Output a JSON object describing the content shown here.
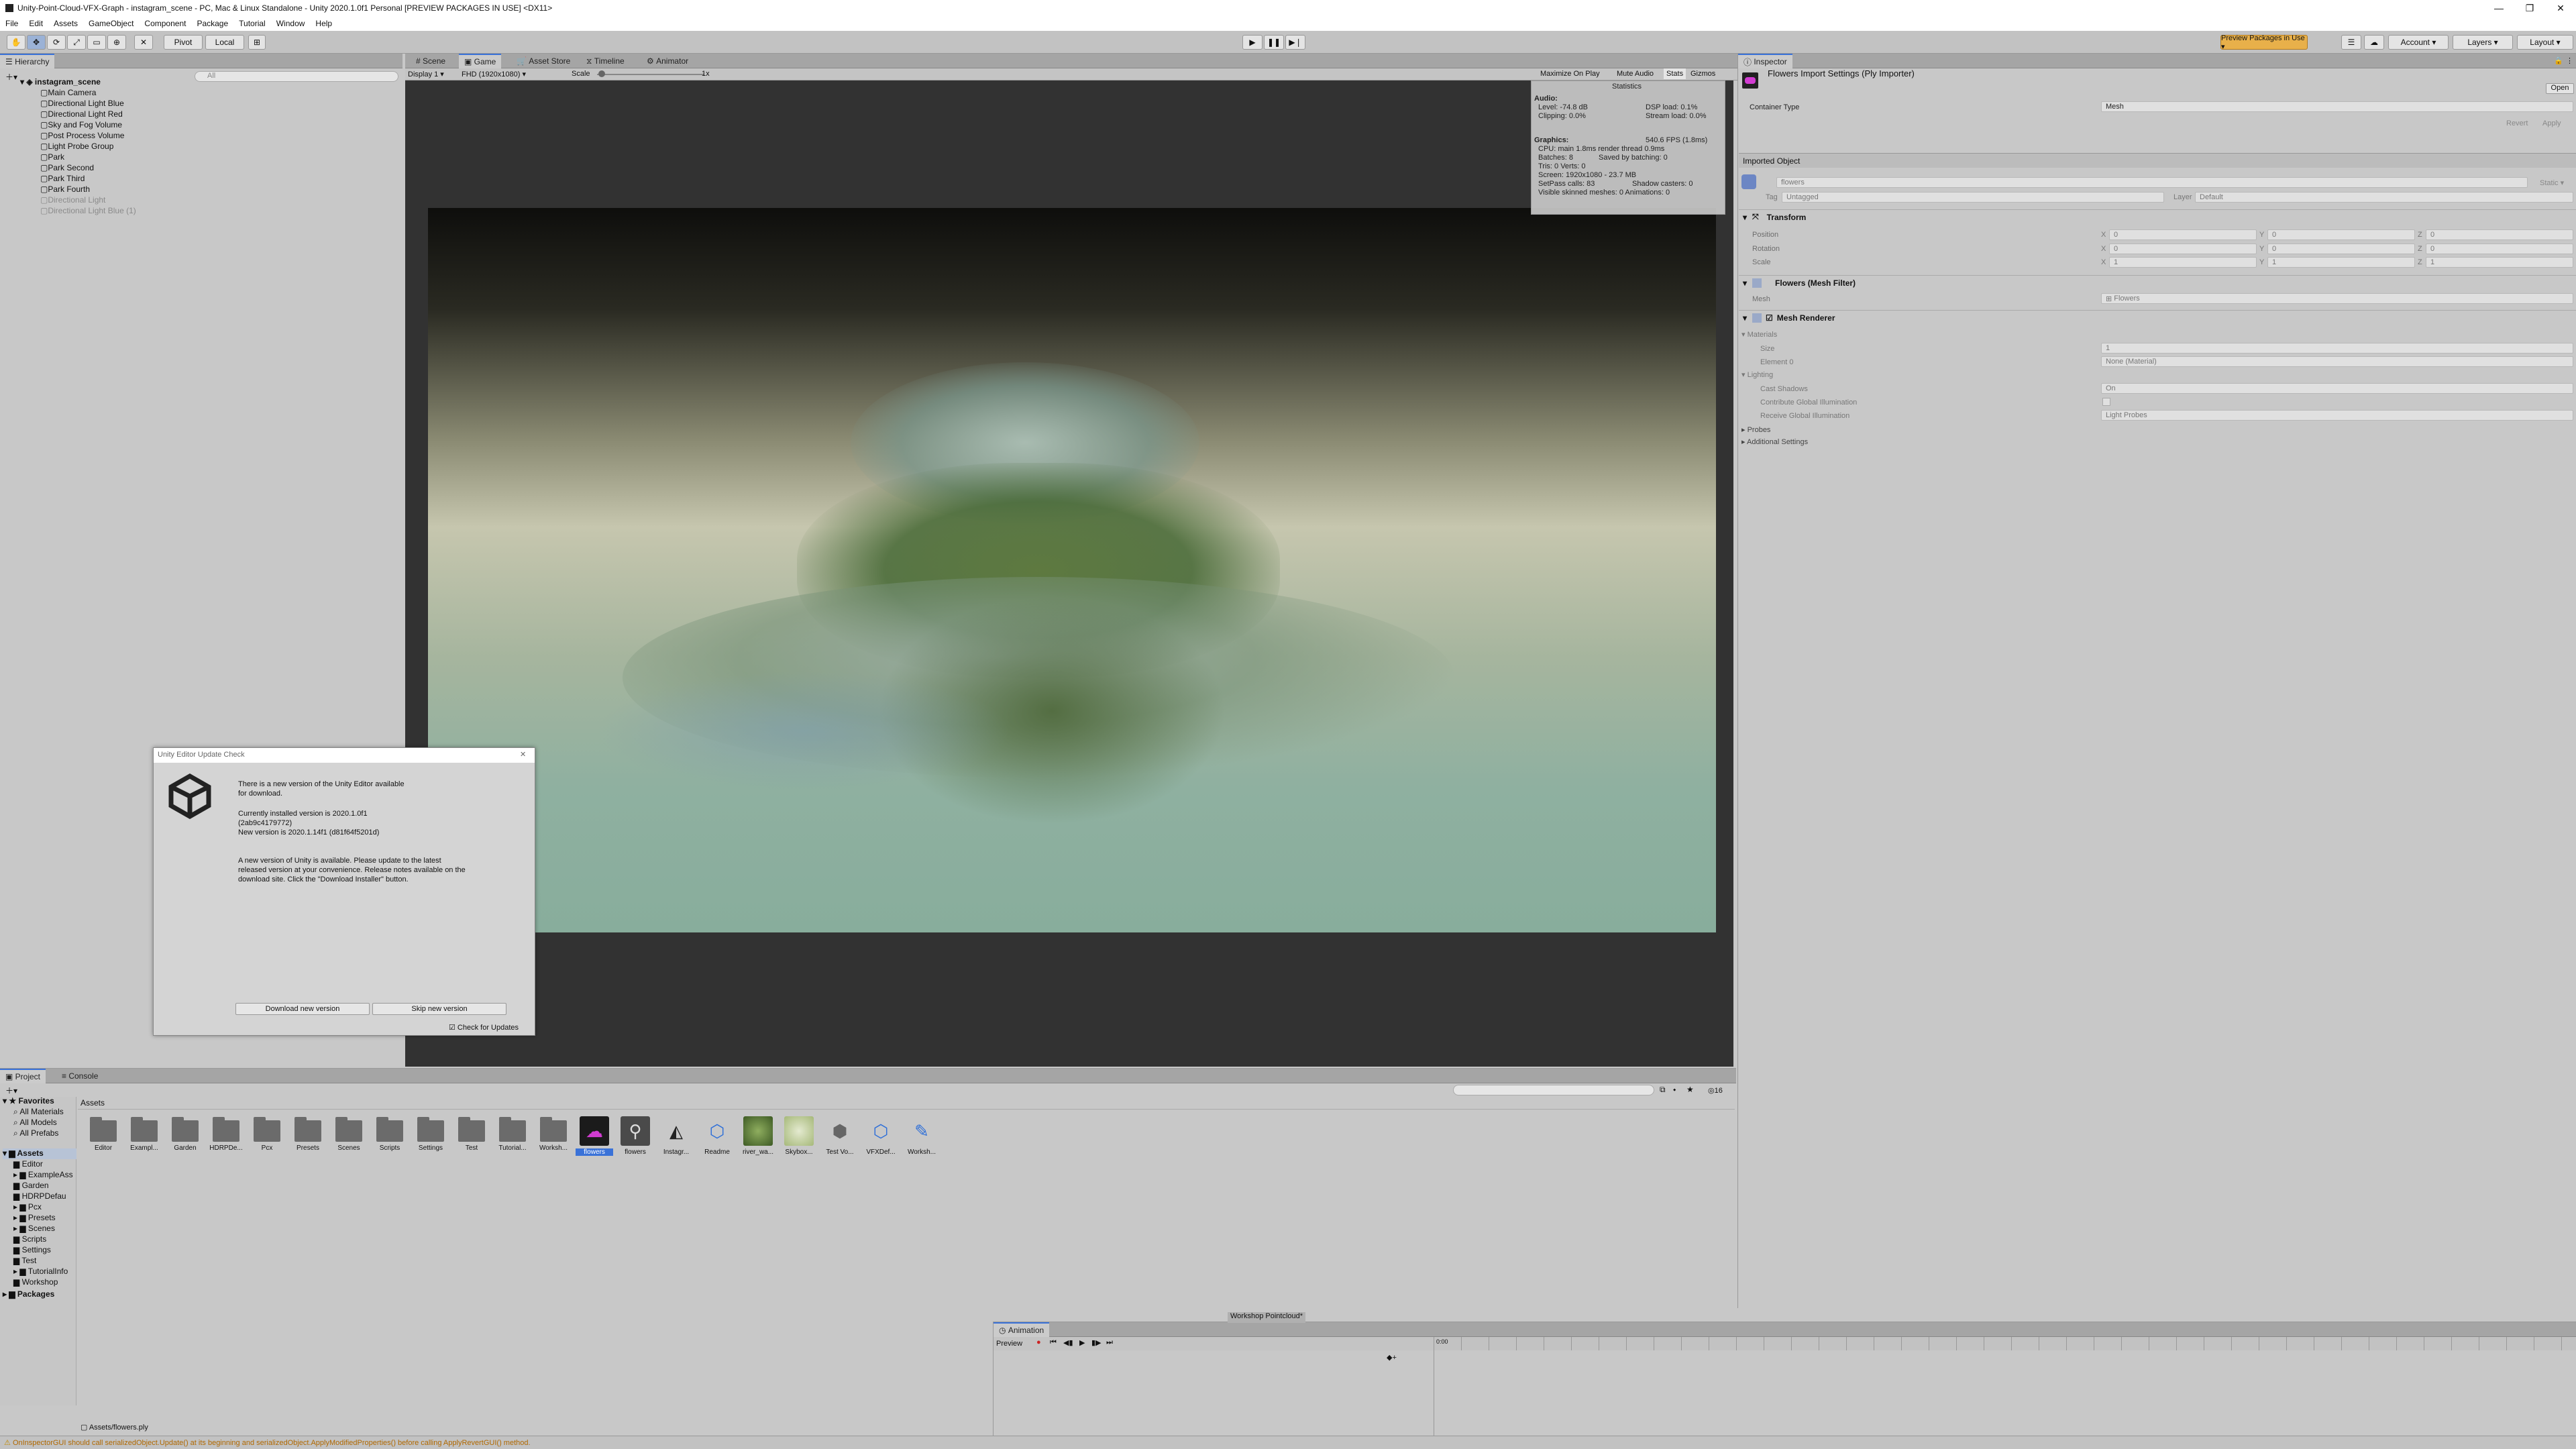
{
  "window": {
    "title": "Unity-Point-Cloud-VFX-Graph - instagram_scene - PC, Mac & Linux Standalone - Unity 2020.1.0f1 Personal [PREVIEW PACKAGES IN USE] <DX11>",
    "controls": [
      "—",
      "❐",
      "✕"
    ]
  },
  "menu": [
    "File",
    "Edit",
    "Assets",
    "GameObject",
    "Component",
    "Package",
    "Tutorial",
    "Window",
    "Help"
  ],
  "toolbar": {
    "pivot": "Pivot",
    "local": "Local",
    "preview_packages": "Preview Packages in Use ▾",
    "account": "Account ▾",
    "layers": "Layers ▾",
    "layout": "Layout ▾"
  },
  "hierarchy": {
    "tab": "Hierarchy",
    "search_placeholder": "All",
    "scene": "instagram_scene",
    "items": [
      {
        "label": "Main Camera",
        "dim": false
      },
      {
        "label": "Directional Light Blue",
        "dim": false
      },
      {
        "label": "Directional Light Red",
        "dim": false
      },
      {
        "label": "Sky and Fog Volume",
        "dim": false
      },
      {
        "label": "Post Process Volume",
        "dim": false
      },
      {
        "label": "Light Probe Group",
        "dim": false
      },
      {
        "label": "Park",
        "dim": false
      },
      {
        "label": "Park Second",
        "dim": false
      },
      {
        "label": "Park Third",
        "dim": false
      },
      {
        "label": "Park Fourth",
        "dim": false
      },
      {
        "label": "Directional Light",
        "dim": true
      },
      {
        "label": "Directional Light Blue (1)",
        "dim": true
      }
    ]
  },
  "center_tabs": [
    "Scene",
    "Game",
    "Asset Store",
    "Timeline",
    "Animator"
  ],
  "game_bar": {
    "display": "Display 1",
    "resolution": "FHD (1920x1080)",
    "scale_label": "Scale",
    "scale_value": "1x",
    "maximize": "Maximize On Play",
    "mute": "Mute Audio",
    "stats": "Stats",
    "gizmos": "Gizmos"
  },
  "statistics": {
    "title": "Statistics",
    "audio_hdr": "Audio:",
    "level": "Level: -74.8 dB",
    "dsp": "DSP load: 0.1%",
    "clipping": "Clipping: 0.0%",
    "stream": "Stream load: 0.0%",
    "graphics_hdr": "Graphics:",
    "fps": "540.6 FPS (1.8ms)",
    "cpu": "CPU: main 1.8ms  render thread 0.9ms",
    "batches": "Batches: 8",
    "saved": "Saved by batching: 0",
    "tris": "Tris: 0   Verts: 0",
    "screen": "Screen: 1920x1080 - 23.7 MB",
    "setpass": "SetPass calls: 83",
    "shadow": "Shadow casters: 0",
    "skinned": "Visible skinned meshes: 0  Animations: 0"
  },
  "update_dialog": {
    "title": "Unity Editor Update Check",
    "line1": "There is a new version of the Unity Editor available",
    "line2": "for download.",
    "current": "Currently installed version is 2020.1.0f1",
    "hash": "(2ab9c4179772)",
    "new_version": "New version is 2020.1.14f1 (d81f64f5201d)",
    "msg1": "A new version of Unity is available. Please update to the latest",
    "msg2": "released version at your convenience. Release notes available on the",
    "msg3": "download site. Click the \"Download Installer\" button.",
    "download_btn": "Download new version",
    "skip_btn": "Skip new version",
    "check_label": "Check for Updates"
  },
  "inspector": {
    "tab": "Inspector",
    "title": "Flowers Import Settings (Ply Importer)",
    "open": "Open",
    "container_label": "Container Type",
    "container_value": "Mesh",
    "revert": "Revert",
    "apply": "Apply",
    "imported_object": "Imported Object",
    "object_name": "flowers",
    "static": "Static ▾",
    "tag_label": "Tag",
    "tag_value": "Untagged",
    "layer_label": "Layer",
    "layer_value": "Default",
    "transform": "Transform",
    "position": "Position",
    "rotation": "Rotation",
    "scale": "Scale",
    "pos": [
      "0",
      "0",
      "0"
    ],
    "rot": [
      "0",
      "0",
      "0"
    ],
    "scl": [
      "1",
      "1",
      "1"
    ],
    "mesh_filter": "Flowers (Mesh Filter)",
    "mesh_label": "Mesh",
    "mesh_value": "Flowers",
    "mesh_renderer": "Mesh Renderer",
    "materials": "Materials",
    "size_label": "Size",
    "size_value": "1",
    "element0_label": "Element 0",
    "element0_value": "None (Material)",
    "lighting": "Lighting",
    "cast_shadows": "Cast Shadows",
    "cast_value": "On",
    "contribute_gi": "Contribute Global Illumination",
    "receive_gi": "Receive Global Illumination",
    "receive_value": "Light Probes",
    "probes": "Probes",
    "additional": "Additional Settings"
  },
  "project": {
    "tabs": [
      "Project",
      "Console"
    ],
    "hidden_count": "16",
    "favorites": "Favorites",
    "fav_items": [
      "All Materials",
      "All Models",
      "All Prefabs"
    ],
    "assets_root": "Assets",
    "tree": [
      "Editor",
      "ExampleAss",
      "Garden",
      "HDRPDefau",
      "Pcx",
      "Presets",
      "Scenes",
      "Scripts",
      "Settings",
      "Test",
      "TutorialInfo",
      "Workshop"
    ],
    "packages": "Packages",
    "breadcrumb": "Assets",
    "assets": [
      {
        "label": "Editor",
        "kind": "folder"
      },
      {
        "label": "Exampl...",
        "kind": "folder"
      },
      {
        "label": "Garden",
        "kind": "folder"
      },
      {
        "label": "HDRPDe...",
        "kind": "folder"
      },
      {
        "label": "Pcx",
        "kind": "folder"
      },
      {
        "label": "Presets",
        "kind": "folder"
      },
      {
        "label": "Scenes",
        "kind": "folder"
      },
      {
        "label": "Scripts",
        "kind": "folder"
      },
      {
        "label": "Settings",
        "kind": "folder"
      },
      {
        "label": "Test",
        "kind": "folder"
      },
      {
        "label": "Tutorial...",
        "kind": "folder"
      },
      {
        "label": "Worksh...",
        "kind": "folder"
      },
      {
        "label": "flowers",
        "kind": "pointcloud-selected"
      },
      {
        "label": "flowers",
        "kind": "mesh"
      },
      {
        "label": "Instagr...",
        "kind": "unity"
      },
      {
        "label": "Readme",
        "kind": "cube"
      },
      {
        "label": "river_wa...",
        "kind": "image"
      },
      {
        "label": "Skybox...",
        "kind": "image2"
      },
      {
        "label": "Test Vo...",
        "kind": "box"
      },
      {
        "label": "VFXDef...",
        "kind": "cube"
      },
      {
        "label": "Worksh...",
        "kind": "vfx"
      }
    ],
    "path": "Assets/flowers.ply"
  },
  "animation": {
    "floating_label": "Workshop Pointcloud*",
    "tab": "Animation",
    "preview": "Preview",
    "ruler_start": "0:00"
  },
  "status_bar": "OnInspectorGUI should call serializedObject.Update() at its beginning and serializedObject.ApplyModifiedProperties() before calling ApplyRevertGUI() method."
}
